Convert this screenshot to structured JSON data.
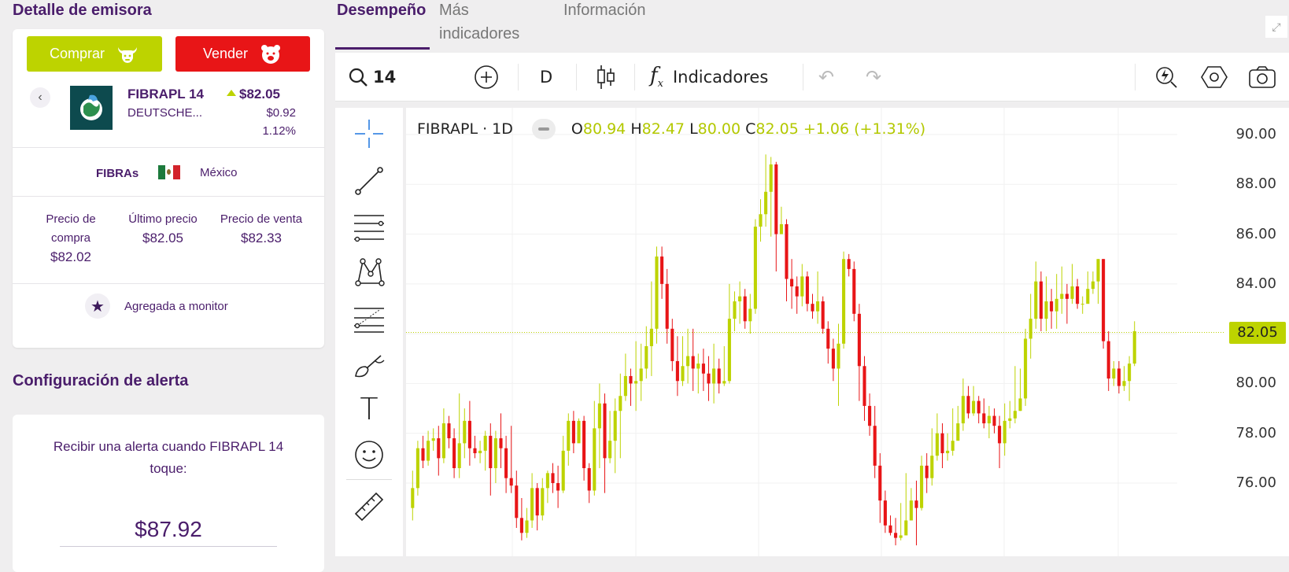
{
  "left": {
    "title": "Detalle de emisora",
    "buy_label": "Comprar",
    "sell_label": "Vender",
    "ticker": "FIBRAPL 14",
    "company": "DEUTSCHE...",
    "price": "$82.05",
    "change": "$0.92",
    "change_pct": "1.12%",
    "sector": "FIBRAs",
    "country": "México",
    "prices": [
      {
        "label": "Precio de compra",
        "value": "$82.02"
      },
      {
        "label": "Último precio",
        "value": "$82.05"
      },
      {
        "label": "Precio de venta",
        "value": "$82.33"
      }
    ],
    "monitor_label": "Agregada a monitor",
    "alert_title": "Configuración de alerta",
    "alert_text": "Recibir una alerta cuando FIBRAPL 14 toque:",
    "alert_value": "$87.92"
  },
  "tabs": [
    "Desempeño",
    "Más indicadores",
    "Información"
  ],
  "toolbar": {
    "search_value": "14",
    "interval": "D",
    "indicators_label": "Indicadores"
  },
  "colors": {
    "up": "#bdd300",
    "down": "#e81517",
    "brand": "#4a1d6b"
  },
  "chart_data": {
    "type": "candlestick",
    "symbol_label": "FIBRAPL · 1D",
    "ohlc": {
      "o_label": "O",
      "o": "80.94",
      "h_label": "H",
      "h": "82.47",
      "l_label": "L",
      "l": "80.00",
      "c_label": "C",
      "c": "82.05",
      "change": "+1.06 (+1.31%)"
    },
    "current_price": "82.05",
    "y_ticks": [
      "90.00",
      "88.00",
      "86.00",
      "84.00",
      "82.00",
      "80.00",
      "78.00",
      "76.00"
    ],
    "ylim": [
      74.0,
      90.5
    ],
    "candles": [
      [
        75,
        75.8,
        76.5,
        74.5
      ],
      [
        75.8,
        77.4,
        77.7,
        75.5
      ],
      [
        77.4,
        76.9,
        77.9,
        76.6
      ],
      [
        76.9,
        77.7,
        78.1,
        76.7
      ],
      [
        77.7,
        77.8,
        78.2,
        77.3
      ],
      [
        77.8,
        77.0,
        78.3,
        76.3
      ],
      [
        77.0,
        78.4,
        79.0,
        76.8
      ],
      [
        78.4,
        77.8,
        78.7,
        77.4
      ],
      [
        77.8,
        76.6,
        78.2,
        76.2
      ],
      [
        76.6,
        77.6,
        79.6,
        76.2
      ],
      [
        77.6,
        78.5,
        79.0,
        77.0
      ],
      [
        78.5,
        77.4,
        79.3,
        76.7
      ],
      [
        77.4,
        77.2,
        77.9,
        77.0
      ],
      [
        77.2,
        77.3,
        77.7,
        76.8
      ],
      [
        77.3,
        77.9,
        78.1,
        76.5
      ],
      [
        77.9,
        76.6,
        78.4,
        75.5
      ],
      [
        76.6,
        77.8,
        78.1,
        76.0
      ],
      [
        77.8,
        77.4,
        78.8,
        76.6
      ],
      [
        77.4,
        76.2,
        77.9,
        75.6
      ],
      [
        76.2,
        75.9,
        78.3,
        75.6
      ],
      [
        75.9,
        74.6,
        76.5,
        74.2
      ],
      [
        74.6,
        74.0,
        75.4,
        73.7
      ],
      [
        74.0,
        74.5,
        75.0,
        73.8
      ],
      [
        74.5,
        75.8,
        76.4,
        74.2
      ],
      [
        75.8,
        74.7,
        76.0,
        74.1
      ],
      [
        74.7,
        75.8,
        76.2,
        74.5
      ],
      [
        75.8,
        76.4,
        76.5,
        75.2
      ],
      [
        76.4,
        76.0,
        76.8,
        75.6
      ],
      [
        76.0,
        75.7,
        76.7,
        75.0
      ],
      [
        75.7,
        77.3,
        77.9,
        75.6
      ],
      [
        77.3,
        78.5,
        78.8,
        76.7
      ],
      [
        78.5,
        77.6,
        78.9,
        77.2
      ],
      [
        77.6,
        78.5,
        78.6,
        78.3
      ],
      [
        78.5,
        76.6,
        78.7,
        76.1
      ],
      [
        76.6,
        75.7,
        76.8,
        75.2
      ],
      [
        75.7,
        78.2,
        79.3,
        75.5
      ],
      [
        78.2,
        79.2,
        80.0,
        76.6
      ],
      [
        79.2,
        77.0,
        79.6,
        75.6
      ],
      [
        77.0,
        77.7,
        78.9,
        76.8
      ],
      [
        77.7,
        78.9,
        79.4,
        76.4
      ],
      [
        78.9,
        79.5,
        80.4,
        77.0
      ],
      [
        79.5,
        80.3,
        81.2,
        79.3
      ],
      [
        80.3,
        80.0,
        80.6,
        79.1
      ],
      [
        80.0,
        80.1,
        81.7,
        78.9
      ],
      [
        80.1,
        80.6,
        81.6,
        79.3
      ],
      [
        80.6,
        81.5,
        82.3,
        80.2
      ],
      [
        81.5,
        82.2,
        84.1,
        80.3
      ],
      [
        82.2,
        85.1,
        85.5,
        81.6
      ],
      [
        85.1,
        84.0,
        85.5,
        83.4
      ],
      [
        84.0,
        82.2,
        84.6,
        81.6
      ],
      [
        82.2,
        80.9,
        82.6,
        80.5
      ],
      [
        80.9,
        80.1,
        81.9,
        79.5
      ],
      [
        80.1,
        80.7,
        81.9,
        79.9
      ],
      [
        80.7,
        81.1,
        82.2,
        80.0
      ],
      [
        81.1,
        80.6,
        82.2,
        79.7
      ],
      [
        80.6,
        80.8,
        81.2,
        79.6
      ],
      [
        80.8,
        80.4,
        81.4,
        79.7
      ],
      [
        80.4,
        80.0,
        81.1,
        79.3
      ],
      [
        80.0,
        80.6,
        81.6,
        79.2
      ],
      [
        80.6,
        80.0,
        81.0,
        79.6
      ],
      [
        80.0,
        80.1,
        81.5,
        79.9
      ],
      [
        80.1,
        82.6,
        84.0,
        80.0
      ],
      [
        82.6,
        83.3,
        83.7,
        82.1
      ],
      [
        83.3,
        83.5,
        84.1,
        82.4
      ],
      [
        83.5,
        82.5,
        83.8,
        82.2
      ],
      [
        82.5,
        83.0,
        83.6,
        82.0
      ],
      [
        83.0,
        86.3,
        86.6,
        82.8
      ],
      [
        86.3,
        86.8,
        87.4,
        85.7
      ],
      [
        86.8,
        87.7,
        89.2,
        86.3
      ],
      [
        87.7,
        88.8,
        89.1,
        85.9
      ],
      [
        88.8,
        86.0,
        88.9,
        84.5
      ],
      [
        86.0,
        86.4,
        87.1,
        86.1
      ],
      [
        86.4,
        84.2,
        86.6,
        83.3
      ],
      [
        84.2,
        83.9,
        85.0,
        83.0
      ],
      [
        83.9,
        83.5,
        84.3,
        82.8
      ],
      [
        83.5,
        84.3,
        84.8,
        83.1
      ],
      [
        84.3,
        83.2,
        84.5,
        82.9
      ],
      [
        83.2,
        82.9,
        83.6,
        82.6
      ],
      [
        82.9,
        83.3,
        84.5,
        82.4
      ],
      [
        83.3,
        82.2,
        83.5,
        82.0
      ],
      [
        82.2,
        81.4,
        82.5,
        80.8
      ],
      [
        81.4,
        80.6,
        81.8,
        80.1
      ],
      [
        80.6,
        81.6,
        82.4,
        79.1
      ],
      [
        81.6,
        85.0,
        85.3,
        81.4
      ],
      [
        85.0,
        84.6,
        85.2,
        84.3
      ],
      [
        84.6,
        82.8,
        84.9,
        82.5
      ],
      [
        82.8,
        80.7,
        83.2,
        79.3
      ],
      [
        80.7,
        79.1,
        81.1,
        78.5
      ],
      [
        79.1,
        78.3,
        79.6,
        77.9
      ],
      [
        78.3,
        76.7,
        79.1,
        76.2
      ],
      [
        76.7,
        75.3,
        77.2,
        74.4
      ],
      [
        75.3,
        74.3,
        75.7,
        74.0
      ],
      [
        74.3,
        74.0,
        74.7,
        73.9
      ],
      [
        74.0,
        73.8,
        74.6,
        73.5
      ],
      [
        73.8,
        73.9,
        75.2,
        73.7
      ],
      [
        73.9,
        74.5,
        76.4,
        74.2
      ],
      [
        74.5,
        75.3,
        75.8,
        74.9
      ],
      [
        75.3,
        75.0,
        76.1,
        73.5
      ],
      [
        75.0,
        76.7,
        77.1,
        74.9
      ],
      [
        76.7,
        76.2,
        77.2,
        75.6
      ],
      [
        76.2,
        77.1,
        78.2,
        75.9
      ],
      [
        77.1,
        78.0,
        78.8,
        76.9
      ],
      [
        78.0,
        77.2,
        78.4,
        76.6
      ],
      [
        77.2,
        77.3,
        78.0,
        76.9
      ],
      [
        77.3,
        77.7,
        79.0,
        77.1
      ],
      [
        77.7,
        78.4,
        79.1,
        78.0
      ],
      [
        78.4,
        79.5,
        80.2,
        78.1
      ],
      [
        79.5,
        78.8,
        79.9,
        78.6
      ],
      [
        78.8,
        79.3,
        79.9,
        78.7
      ],
      [
        79.3,
        78.8,
        79.5,
        78.4
      ],
      [
        78.8,
        78.4,
        79.4,
        78.2
      ],
      [
        78.4,
        78.7,
        79.1,
        77.8
      ],
      [
        78.7,
        78.3,
        79.0,
        78.0
      ],
      [
        78.3,
        77.6,
        78.7,
        76.6
      ],
      [
        77.6,
        78.5,
        79.2,
        77.1
      ],
      [
        78.5,
        78.6,
        79.3,
        78.2
      ],
      [
        78.6,
        78.9,
        80.7,
        78.4
      ],
      [
        78.9,
        79.4,
        80.6,
        78.9
      ],
      [
        79.4,
        81.8,
        82.2,
        79.1
      ],
      [
        81.8,
        82.6,
        83.6,
        81.0
      ],
      [
        82.6,
        84.1,
        84.9,
        82.2
      ],
      [
        84.1,
        82.6,
        84.5,
        82.1
      ],
      [
        82.6,
        83.3,
        84.3,
        82.1
      ],
      [
        83.3,
        82.9,
        83.8,
        82.2
      ],
      [
        82.9,
        83.4,
        84.4,
        82.2
      ],
      [
        83.4,
        83.6,
        84.7,
        82.8
      ],
      [
        83.6,
        83.4,
        84.0,
        82.4
      ],
      [
        83.4,
        83.9,
        84.8,
        83.2
      ],
      [
        83.9,
        83.2,
        84.2,
        83.0
      ],
      [
        83.2,
        83.2,
        83.5,
        82.8
      ],
      [
        83.2,
        83.8,
        84.5,
        83.5
      ],
      [
        83.8,
        84.1,
        84.5,
        83.6
      ],
      [
        84.1,
        85.0,
        85.0,
        83.2
      ],
      [
        85.0,
        81.7,
        85.0,
        81.4
      ],
      [
        81.7,
        80.2,
        82.1,
        79.7
      ],
      [
        80.2,
        80.6,
        80.9,
        79.9
      ],
      [
        80.6,
        79.9,
        80.9,
        79.6
      ],
      [
        79.9,
        80.1,
        80.7,
        79.7
      ],
      [
        80.1,
        80.8,
        81.1,
        79.3
      ],
      [
        80.8,
        82.1,
        82.5,
        80.7
      ]
    ]
  }
}
